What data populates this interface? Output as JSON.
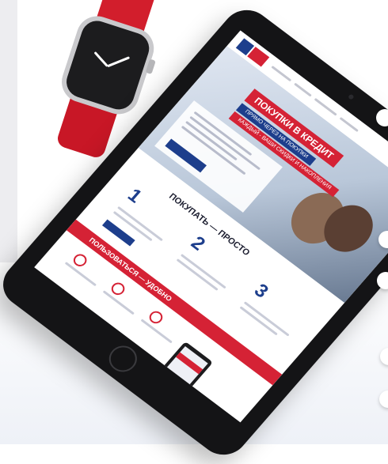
{
  "scene": {
    "background_color": "#ffffff",
    "left_panel_color": "#ededf0"
  },
  "watch": {
    "strap_color": "#d21e2c",
    "case_color": "#c9c9cc",
    "face_color": "#1c1c1e"
  },
  "tablet": {
    "bezel_color": "#141416",
    "website": {
      "hero_title": "ПОКУПКИ В КРЕДИТ",
      "hero_subtitle": "ПРЯМО ЧЕРЕЗ НА ПОКУПКИ",
      "hero_subtitle_2": "КАЖДЫЙ - ВАШИ СКИДКИ И НАКОПЛЕНИЯ",
      "section_buy_title": "ПОКУПАТЬ — ПРОСТО",
      "step_numbers": [
        "1",
        "2",
        "3"
      ],
      "section_use_title": "ПОЛЬЗОВАТЬСЯ — УДОБНО",
      "brand_blue": "#1d3e8c",
      "brand_red": "#d52235"
    }
  }
}
